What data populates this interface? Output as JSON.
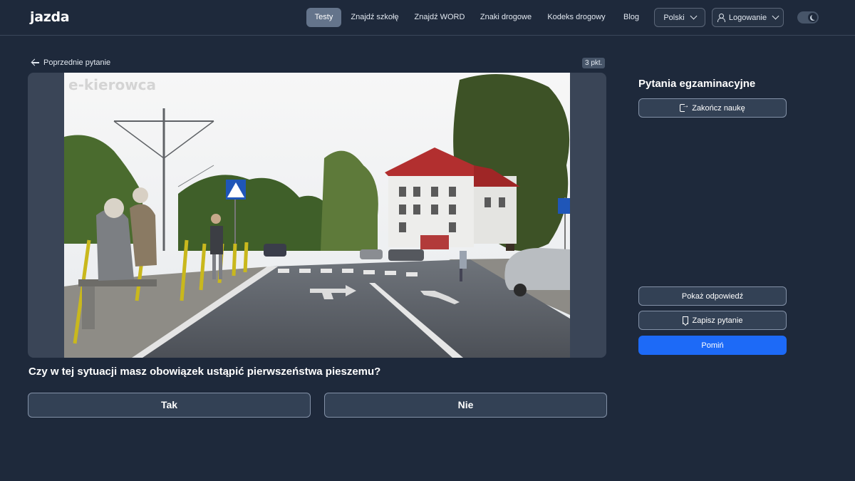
{
  "brand": {
    "name": "jazda"
  },
  "nav": {
    "items": [
      {
        "label": "Testy",
        "active": true
      },
      {
        "label": "Znajdź szkołę"
      },
      {
        "label": "Znajdź WORD"
      },
      {
        "label": "Znaki drogowe"
      },
      {
        "label": "Kodeks drogowy"
      },
      {
        "label": "Blog"
      }
    ],
    "language": "Polski",
    "login": "Logowanie"
  },
  "question": {
    "back_label": "Poprzednie pytanie",
    "points": "3 pkt.",
    "watermark": "e-kierowca",
    "text": "Czy w tej sytuacji masz obowiązek ustąpić pierwszeństwa pieszemu?",
    "answers": [
      {
        "label": "Tak"
      },
      {
        "label": "Nie"
      }
    ]
  },
  "sidebar": {
    "title": "Pytania egzaminacyjne",
    "end_label": "Zakończ naukę",
    "show_answer": "Pokaż odpowiedź",
    "save_question": "Zapisz pytanie",
    "skip": "Pomiń"
  },
  "colors": {
    "background": "#1e293b",
    "primary": "#1d6af7",
    "accent": "#3b82f6"
  }
}
